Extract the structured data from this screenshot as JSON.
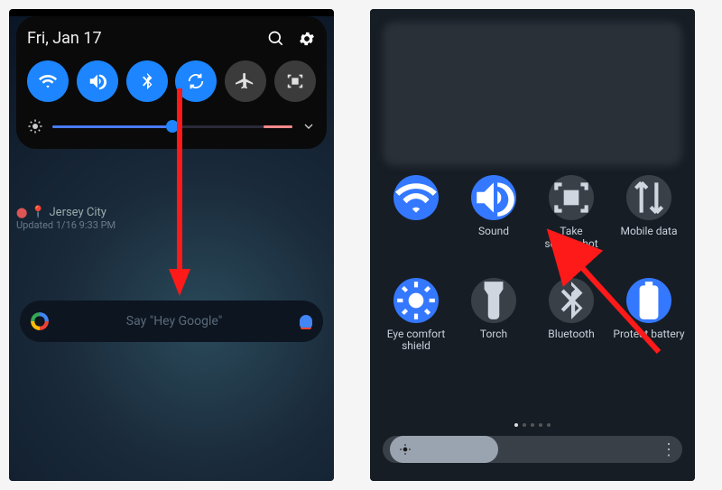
{
  "left": {
    "date": "Fri, Jan 17",
    "tiles": [
      {
        "name": "wifi",
        "active": true
      },
      {
        "name": "sound",
        "active": true
      },
      {
        "name": "bluetooth",
        "active": true
      },
      {
        "name": "rotate",
        "active": true
      },
      {
        "name": "airplane",
        "active": false
      },
      {
        "name": "screenshot",
        "active": false
      }
    ],
    "brightness_percent": 50,
    "homescreen": {
      "location": "Jersey City",
      "updated": "Updated 1/16 9:33 PM",
      "google_hint": "Say \"Hey Google\""
    }
  },
  "right": {
    "tiles_row1": [
      {
        "name": "wifi",
        "label": "",
        "active": true
      },
      {
        "name": "sound",
        "label": "Sound",
        "active": true
      },
      {
        "name": "take-screenshot",
        "label": "Take screenshot",
        "active": false
      },
      {
        "name": "mobile-data",
        "label": "Mobile data",
        "active": false
      }
    ],
    "tiles_row2": [
      {
        "name": "eye-comfort",
        "label": "Eye comfort shield",
        "active": true
      },
      {
        "name": "torch",
        "label": "Torch",
        "active": false
      },
      {
        "name": "bluetooth",
        "label": "Bluetooth",
        "active": false
      },
      {
        "name": "protect-battery",
        "label": "Protect battery",
        "active": true
      }
    ],
    "page_indicator": {
      "count": 5,
      "active": 0
    },
    "brightness_percent": 38
  }
}
